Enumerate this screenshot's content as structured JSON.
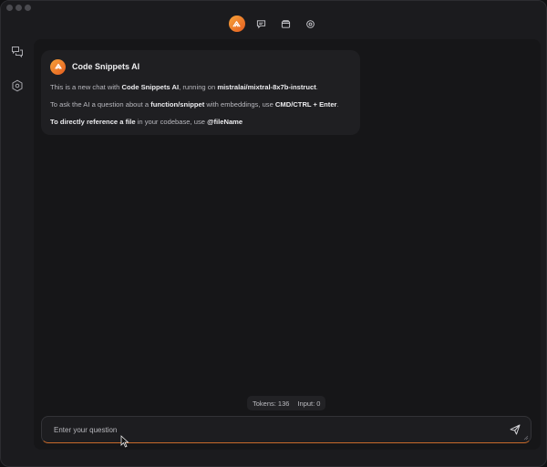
{
  "topnav": {
    "items": [
      {
        "name": "code-snippets-ai",
        "icon": "logo-icon",
        "active": true
      },
      {
        "name": "chat",
        "icon": "chat-bubble-icon",
        "active": false
      },
      {
        "name": "snippets",
        "icon": "folder-icon",
        "active": false
      },
      {
        "name": "settings",
        "icon": "gear-icon",
        "active": false
      }
    ]
  },
  "sidebar": {
    "items": [
      {
        "icon": "chat-history-icon"
      },
      {
        "icon": "settings-hexagon-icon"
      }
    ]
  },
  "message": {
    "sender": "Code Snippets AI",
    "line1": {
      "pre": "This is a new chat with ",
      "app": "Code Snippets AI",
      "mid": ", running on ",
      "model": "mistralai/mixtral-8x7b-instruct",
      "post": "."
    },
    "line2": {
      "pre": "To ask the AI a question about a ",
      "target": "function/snippet",
      "mid": " with embeddings, use ",
      "shortcut": "CMD/CTRL + Enter",
      "post": "."
    },
    "line3": {
      "lead": "To directly reference a file",
      "mid": " in your codebase, use ",
      "syntax": "@fileName"
    }
  },
  "status": {
    "tokens_label": "Tokens: 136",
    "input_label": "Input: 0"
  },
  "composer": {
    "placeholder": "Enter your question",
    "value": ""
  },
  "colors": {
    "accent_start": "#f7a33a",
    "accent_end": "#e55d1f",
    "background": "#161618",
    "bubble": "#1f1f22"
  }
}
